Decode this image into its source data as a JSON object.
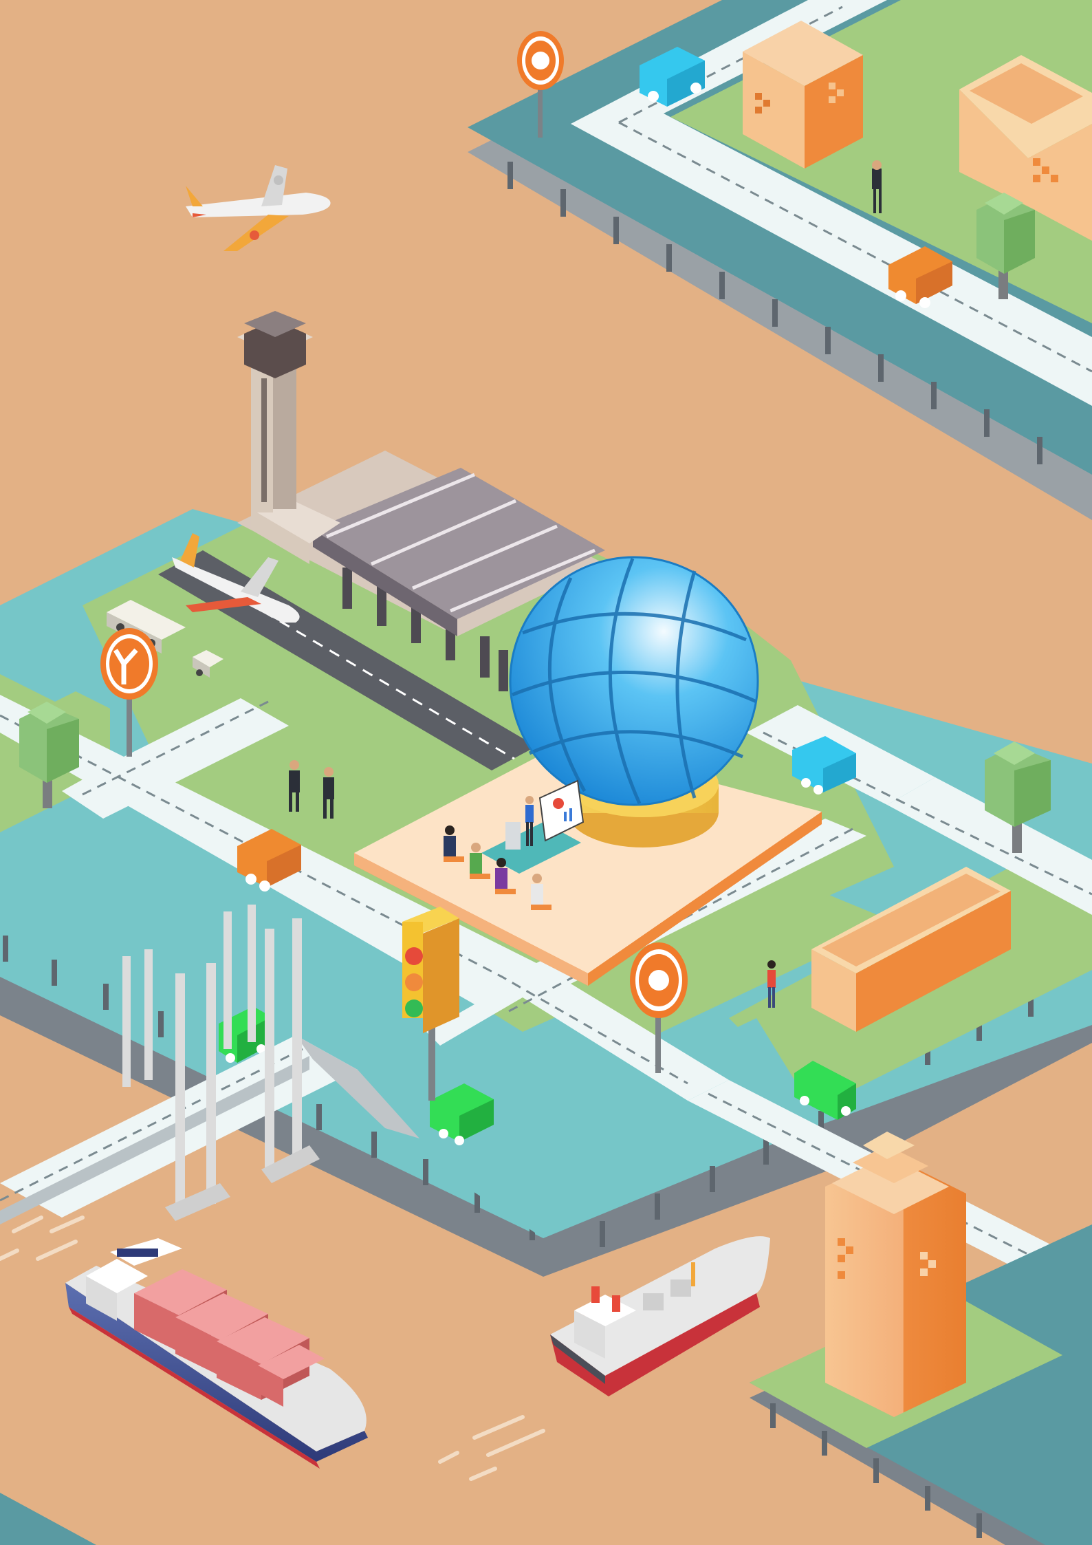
{
  "scene": {
    "name": "isometric-smart-city-illustration",
    "colors": {
      "sand": "#e3b185",
      "water": "#76c6c8",
      "water_dark": "#5a9aa2",
      "grass": "#a3cc80",
      "road": "#eef6f6",
      "pier": "#6f7780",
      "globe": "#2aa6e8",
      "globe_base": "#f2c74e",
      "orange": "#f08a3c",
      "peach": "#f6c38e",
      "plaza": "#fde3c6",
      "sign_orange": "#f07a2a",
      "car_green": "#33dd55",
      "car_cyan": "#35c8ee",
      "car_orange": "#ef8a30"
    },
    "icons": [
      "globe-icon",
      "split-arrow-icon",
      "gear-icon",
      "snowflake-icon",
      "bluetooth-icon"
    ]
  }
}
